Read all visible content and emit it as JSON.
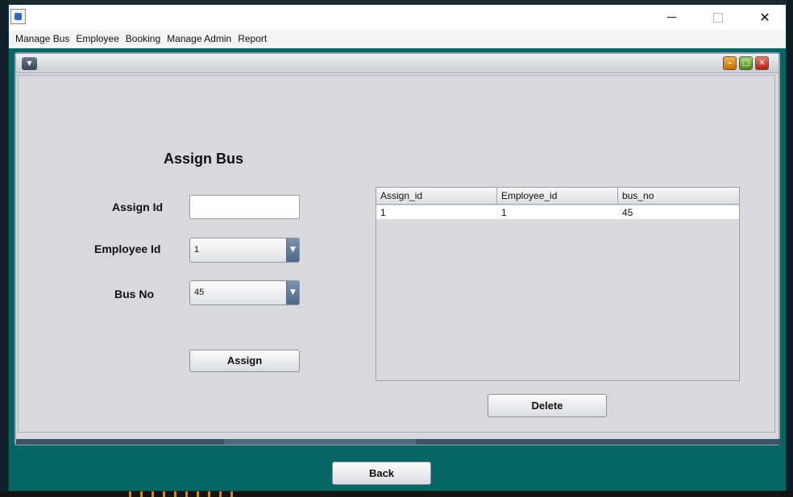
{
  "window": {
    "controls": {
      "minimize": "minimize-icon",
      "maximize": "maximize-icon",
      "close": "close-icon"
    }
  },
  "menubar": {
    "items": [
      "Manage Bus",
      "Employee",
      "Booking",
      "Manage Admin",
      "Report"
    ]
  },
  "form": {
    "title": "Assign Bus",
    "assign_id_label": "Assign Id",
    "assign_id_value": "",
    "employee_id_label": "Employee Id",
    "employee_id_value": "1",
    "bus_no_label": "Bus No",
    "bus_no_value": "45",
    "assign_button": "Assign"
  },
  "table": {
    "columns": [
      "Assign_id",
      "Employee_id",
      "bus_no"
    ],
    "rows": [
      [
        "1",
        "1",
        "45"
      ]
    ]
  },
  "actions": {
    "delete_button": "Delete",
    "back_button": "Back"
  },
  "colors": {
    "desktop_teal": "#056664",
    "frame_bg": "#d7d9de"
  }
}
